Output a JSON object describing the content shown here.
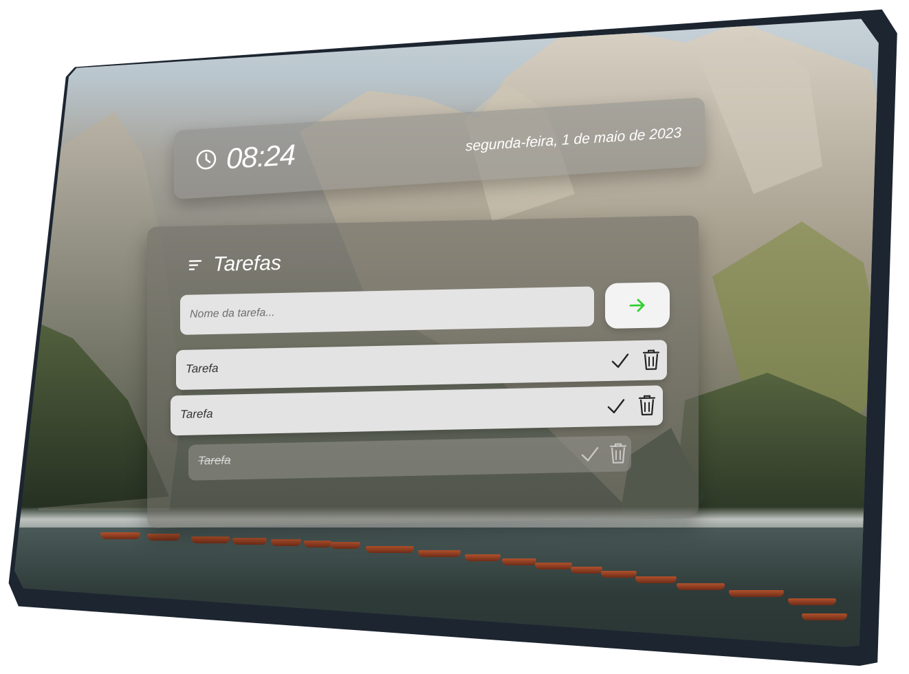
{
  "clock": {
    "time": "08:24",
    "date": "segunda-feira, 1 de maio de 2023"
  },
  "tasks_panel": {
    "title": "Tarefas",
    "input_placeholder": "Nome da tarefa...",
    "input_value": "",
    "items": [
      {
        "label": "Tarefa",
        "completed": false
      },
      {
        "label": "Tarefa",
        "completed": false
      },
      {
        "label": "Tarefa",
        "completed": true
      }
    ]
  },
  "colors": {
    "accent_arrow": "#2fd02f",
    "panel_glass": "rgba(110,108,100,0.55)"
  },
  "icons": {
    "clock": "clock-icon",
    "list": "list-icon",
    "add": "arrow-right-icon",
    "complete": "check-icon",
    "delete": "trash-icon"
  }
}
